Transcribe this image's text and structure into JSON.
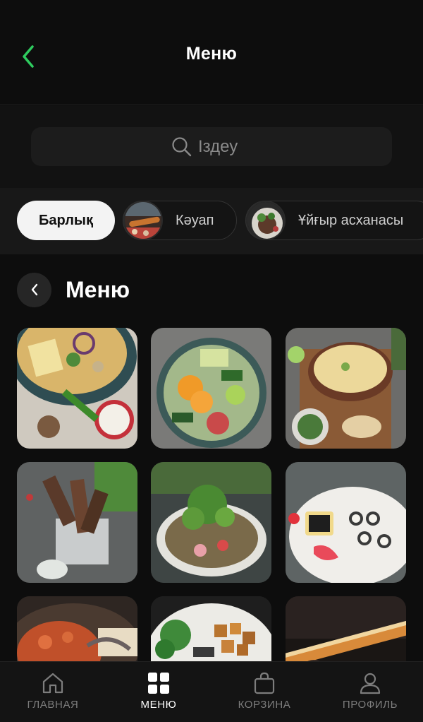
{
  "header": {
    "title": "Меню"
  },
  "search": {
    "placeholder": "Іздеу"
  },
  "categories": [
    {
      "label": "Барлық",
      "active": true
    },
    {
      "label": "Кәуап",
      "active": false
    },
    {
      "label": "Ұйғыр асханасы",
      "active": false
    }
  ],
  "section": {
    "title": "Меню"
  },
  "tabs": [
    {
      "label": "ГЛАВНАЯ",
      "icon": "home-icon",
      "active": false
    },
    {
      "label": "МЕНЮ",
      "icon": "grid-icon",
      "active": true
    },
    {
      "label": "КОРЗИНА",
      "icon": "bag-icon",
      "active": false
    },
    {
      "label": "ПРОФИЛЬ",
      "icon": "user-icon",
      "active": false
    }
  ],
  "colors": {
    "accent": "#2ecc5f",
    "background": "#0d0d0d",
    "surface": "#1c1c1c"
  }
}
